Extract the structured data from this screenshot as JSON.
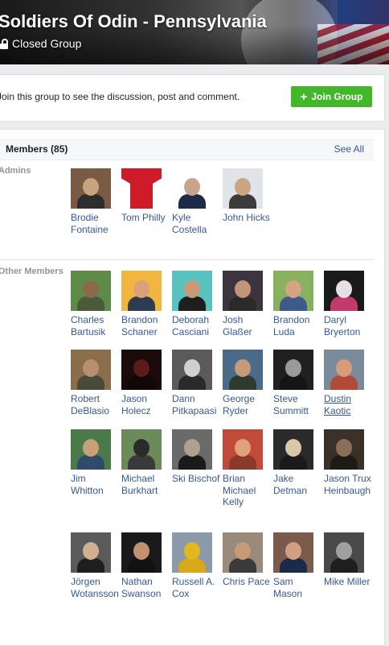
{
  "group": {
    "title": "Soldiers Of Odin - Pennsylvania",
    "privacy": "Closed Group"
  },
  "join_bar": {
    "message": "Join this group to see the discussion, post and comment.",
    "button_label": "Join Group",
    "button_icon": "plus-icon",
    "button_color": "#42b72a"
  },
  "members": {
    "title": "Members (85)",
    "see_all": "See All",
    "admins_label": "Admins",
    "others_label": "Other Members",
    "admins": [
      {
        "name": "Brodie Fontaine",
        "photo": [
          "#7a5a44",
          "#c9a27e",
          "#2d2d2d"
        ]
      },
      {
        "name": "Tom Philly",
        "photo": [
          "#ffffff",
          "#cf1a2a",
          "#cf1a2a"
        ],
        "keystone": true
      },
      {
        "name": "Kyle Costella",
        "photo": [
          "#ffffff",
          "#c8a58a",
          "#1e2a48"
        ]
      },
      {
        "name": "John Hicks",
        "photo": [
          "#e0e4e8",
          "#c9a584",
          "#3b3b3b"
        ]
      }
    ],
    "others": [
      {
        "name": "Charles Bartusik",
        "photo": [
          "#5e8a4a",
          "#8a6a4a",
          "#4a5a3a"
        ]
      },
      {
        "name": "Brandon Schaner",
        "photo": [
          "#f2b640",
          "#d9a07a",
          "#2e3c52"
        ]
      },
      {
        "name": "Deborah Casciani",
        "photo": [
          "#59c2c0",
          "#c99a76",
          "#1e1e1e"
        ]
      },
      {
        "name": "Josh Glaßer",
        "photo": [
          "#3d3440",
          "#c29478",
          "#2a2a2a"
        ]
      },
      {
        "name": "Brandon Luda",
        "photo": [
          "#88b05e",
          "#d4a480",
          "#3e5a8c"
        ]
      },
      {
        "name": "Daryl Bryerton",
        "photo": [
          "#1a1a1a",
          "#e6e0e6",
          "#c23a6a"
        ]
      },
      {
        "name": "Robert DeBlasio",
        "photo": [
          "#8a6d4a",
          "#b89070",
          "#4a4a3a"
        ]
      },
      {
        "name": "Jason Holecz",
        "photo": [
          "#1a0a0a",
          "#5c1a1a",
          "#120606"
        ]
      },
      {
        "name": "Dann Pitkapaasi",
        "photo": [
          "#5a5a5a",
          "#d0d0d0",
          "#2a2a2a"
        ]
      },
      {
        "name": "George Ryder",
        "photo": [
          "#4a6a8a",
          "#c49a78",
          "#2d3a2d"
        ]
      },
      {
        "name": "Steve Summitt",
        "photo": [
          "#202020",
          "#9a9a9a",
          "#151515"
        ]
      },
      {
        "name": "Dustin Kaotic",
        "photo": [
          "#7a8a9a",
          "#d89a78",
          "#b04a3a"
        ],
        "underline": true
      },
      {
        "name": "Jim Whitton",
        "photo": [
          "#4a7a4a",
          "#c8a07a",
          "#2f4a6a"
        ]
      },
      {
        "name": "Michael Burkhart",
        "photo": [
          "#6a8a5a",
          "#2a2a2a",
          "#3a3a3a"
        ]
      },
      {
        "name": "Ski Bischof",
        "photo": [
          "#6a6a6a",
          "#b0a090",
          "#1a1a1a"
        ]
      },
      {
        "name": "Brian Michael Kelly",
        "photo": [
          "#c24a3a",
          "#e0a07a",
          "#8a3a2a"
        ]
      },
      {
        "name": "Jake Detman",
        "photo": [
          "#2a2a2a",
          "#d8c8a8",
          "#1a1a1a"
        ]
      },
      {
        "name": "Jason Trux Heinbaugh",
        "photo": [
          "#3a3028",
          "#8a7058",
          "#1e1a16"
        ]
      },
      {
        "name": "Jörgen Wotansson",
        "photo": [
          "#5a5a5a",
          "#d0b090",
          "#1e1e1e"
        ]
      },
      {
        "name": "Nathan Swanson",
        "photo": [
          "#1a1a1a",
          "#c09070",
          "#111111"
        ]
      },
      {
        "name": "Russell A. Cox",
        "photo": [
          "#8a9aaa",
          "#e2b820",
          "#d8a818"
        ]
      },
      {
        "name": "Chris Pace",
        "photo": [
          "#9a8a7a",
          "#c89a7a",
          "#3a3a3a"
        ]
      },
      {
        "name": "Sam Mason",
        "photo": [
          "#7a5a4a",
          "#d0a080",
          "#1a2a4a"
        ]
      },
      {
        "name": "Mike Miller",
        "photo": [
          "#4a4a4a",
          "#a0a0a0",
          "#1e1e1e"
        ]
      }
    ]
  }
}
